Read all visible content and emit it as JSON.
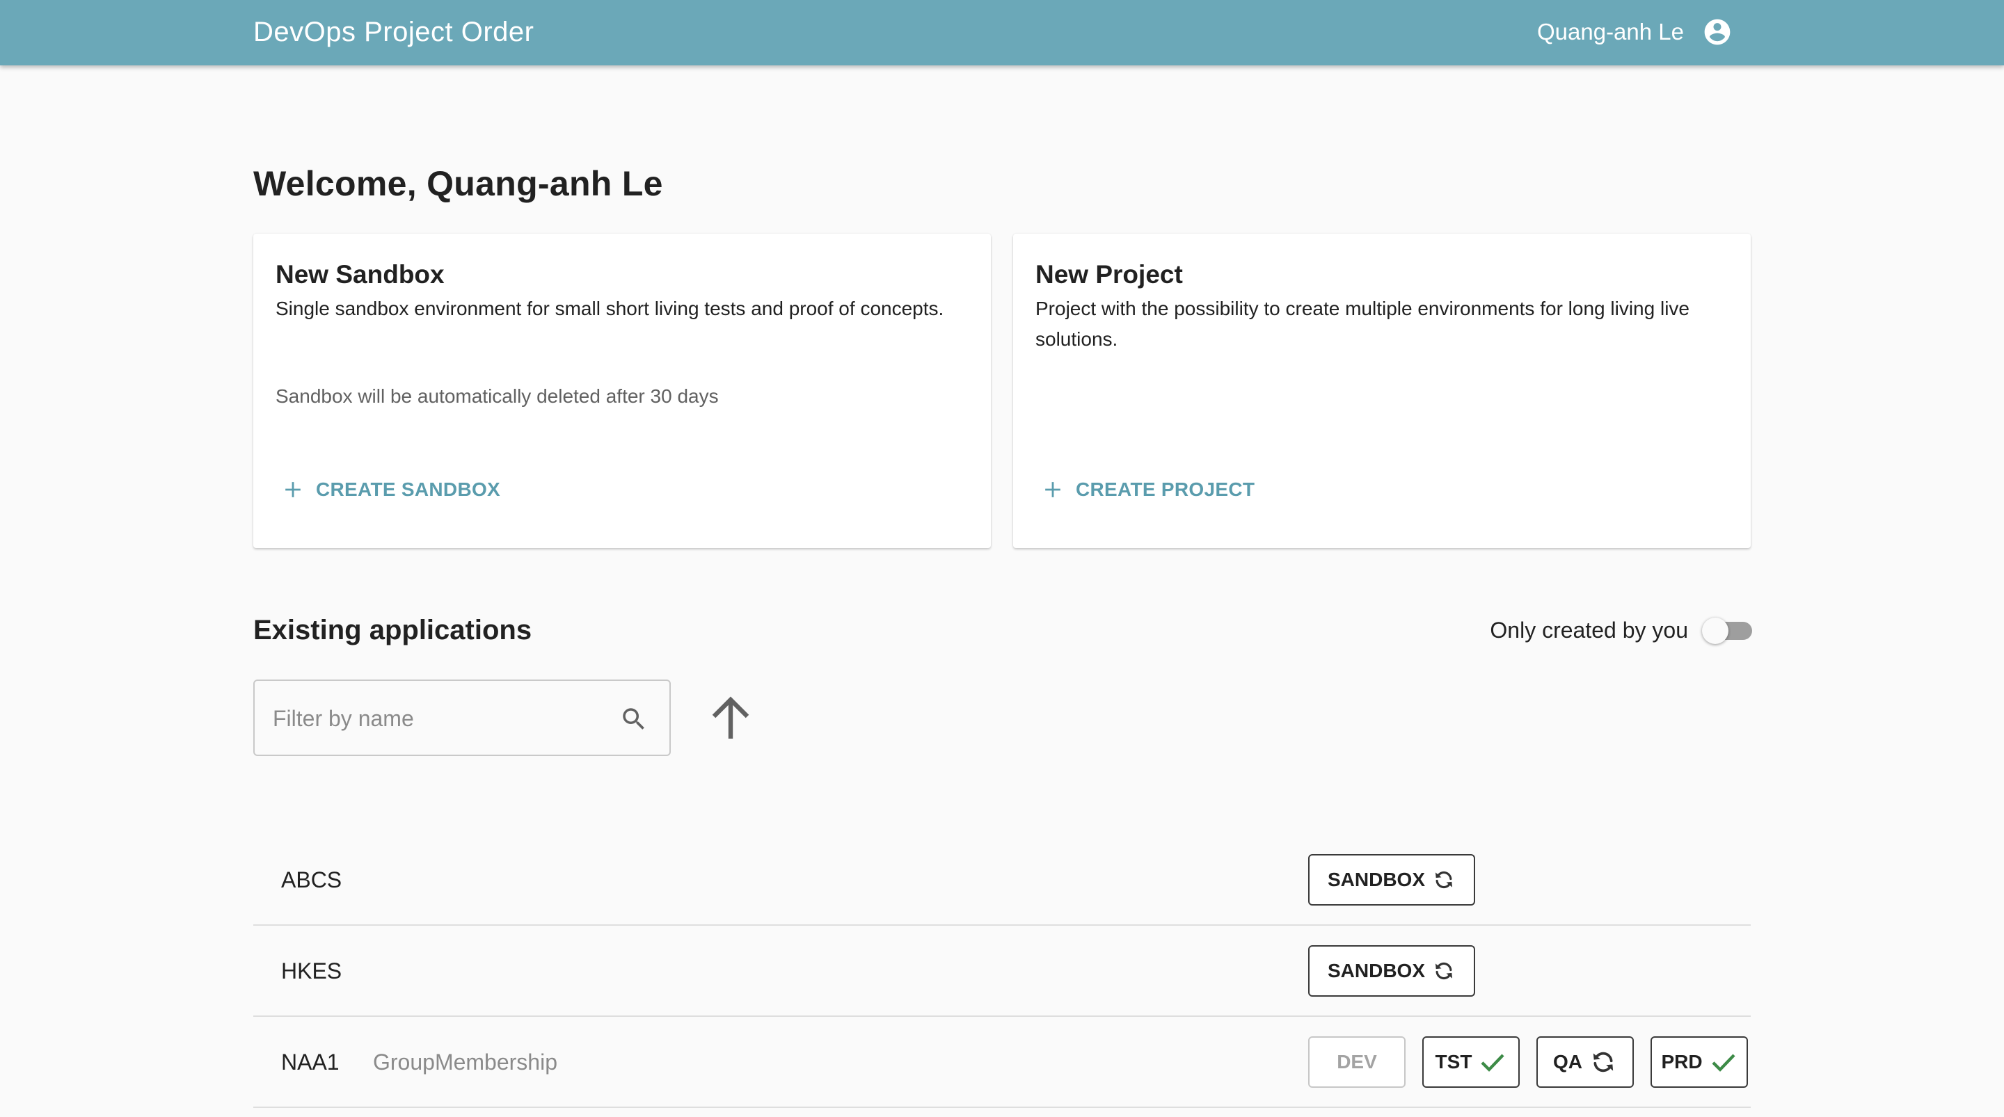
{
  "header": {
    "title": "DevOps Project Order",
    "user_name": "Quang-anh Le",
    "avatar_icon": "account-circle-icon"
  },
  "welcome": "Welcome, Quang-anh Le",
  "cards": {
    "sandbox": {
      "title": "New Sandbox",
      "description": "Single sandbox environment for small short living tests and proof of concepts.",
      "note": "Sandbox will be automatically deleted after 30 days",
      "action_label": "CREATE SANDBOX",
      "action_icon": "plus-icon"
    },
    "project": {
      "title": "New Project",
      "description": "Project with the possibility to create multiple environments for long living live solutions.",
      "action_label": "CREATE PROJECT",
      "action_icon": "plus-icon"
    }
  },
  "applications": {
    "title": "Existing applications",
    "only_mine_label": "Only created by you",
    "only_mine_enabled": false,
    "filter_placeholder": "Filter by name",
    "sort_icon": "arrow-up-icon",
    "rows": [
      {
        "name": "ABCS",
        "description": "",
        "envs": [
          {
            "label": "SANDBOX",
            "status": "syncing",
            "icon": "sync-icon"
          }
        ]
      },
      {
        "name": "HKES",
        "description": "",
        "envs": [
          {
            "label": "SANDBOX",
            "status": "syncing",
            "icon": "sync-icon"
          }
        ]
      },
      {
        "name": "NAA1",
        "description": "GroupMembership",
        "envs": [
          {
            "label": "DEV",
            "status": "disabled",
            "icon": ""
          },
          {
            "label": "TST",
            "status": "done",
            "icon": "check-icon"
          },
          {
            "label": "QA",
            "status": "syncing",
            "icon": "sync-icon"
          },
          {
            "label": "PRD",
            "status": "done",
            "icon": "check-icon"
          }
        ]
      }
    ]
  },
  "colors": {
    "appbar": "#6ba8b8",
    "accent": "#5a9cad",
    "check": "#3d8b47"
  }
}
